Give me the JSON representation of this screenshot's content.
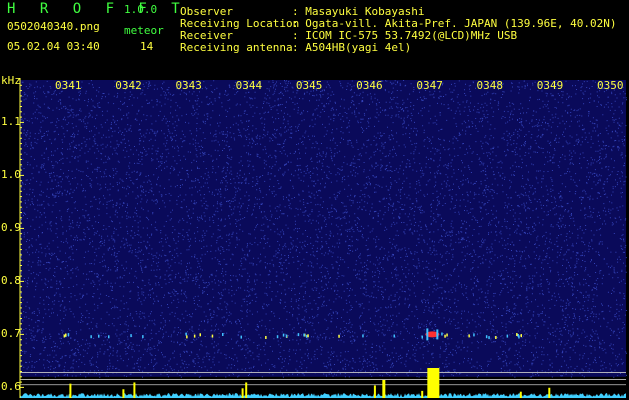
{
  "app": {
    "name": "H R O F F T",
    "version": "1.0.0"
  },
  "file": {
    "name": "0502040340.png",
    "datetime": "05.02.04 03:40"
  },
  "meteor": {
    "label": "meteor",
    "count": "14"
  },
  "info": [
    {
      "label": "Observer",
      "value": ": Masayuki Kobayashi"
    },
    {
      "label": "Receiving Location",
      "value": ": Ogata-vill. Akita-Pref. JAPAN (139.96E, 40.02N)"
    },
    {
      "label": "Receiver",
      "value": ": ICOM IC-575 53.7492(@LCD)MHz USB"
    },
    {
      "label": "Receiving antenna",
      "value": ": A504HB(yagi 4el)"
    }
  ],
  "chart_data": {
    "type": "heatmap",
    "ylabel": "kHz",
    "time_ticks": [
      "0341",
      "0342",
      "0343",
      "0344",
      "0345",
      "0346",
      "0347",
      "0348",
      "0349",
      "0350"
    ],
    "freq_ticks": [
      "1.1",
      "1.0",
      "0.9",
      "0.8",
      "0.7",
      "0.6"
    ],
    "ylim": [
      0.58,
      1.18
    ],
    "echo_freq": 0.7,
    "strong_echo_time": "0347",
    "colors": {
      "background": "#0a0a5a",
      "noise": "#3b4cc8",
      "text": "#ffff40",
      "accent": "#40ff40",
      "power": "#ffff00"
    }
  }
}
